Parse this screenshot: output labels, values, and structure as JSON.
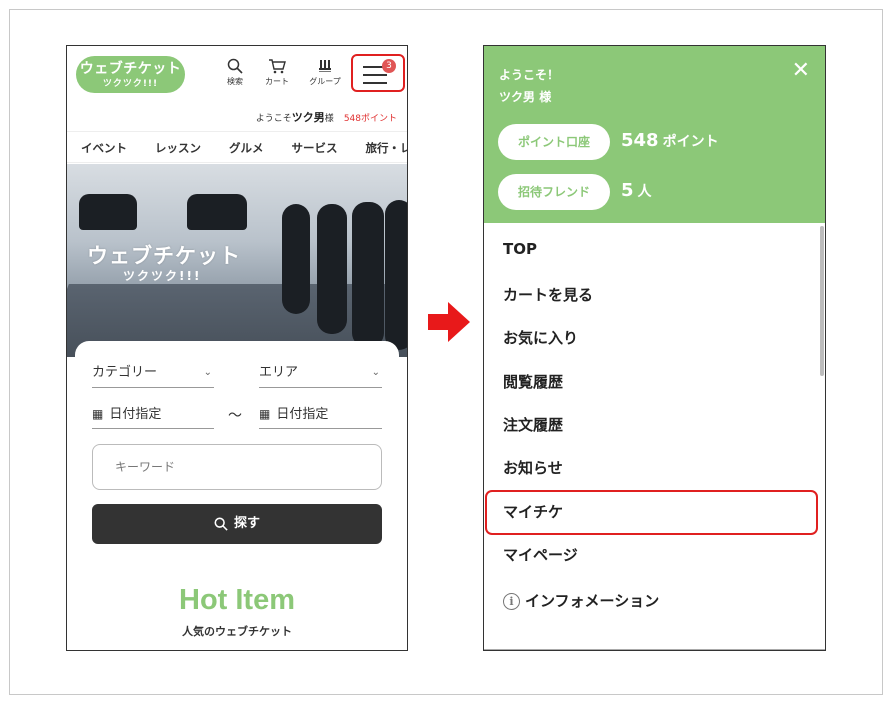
{
  "left": {
    "logo": {
      "line1": "ウェブチケット",
      "line2": "ツクツク!!!"
    },
    "header_icons": [
      {
        "name": "search-icon",
        "label": "検索"
      },
      {
        "name": "cart-icon",
        "label": "カート"
      },
      {
        "name": "group-icon",
        "label": "グループ"
      }
    ],
    "menu_badge": "3",
    "welcome": {
      "prefix": "ようこそ",
      "user": "ツク男",
      "suffix": "様",
      "points": "548ポイント"
    },
    "categories": [
      "イベント",
      "レッスン",
      "グルメ",
      "サービス",
      "旅行・レジ"
    ],
    "hero": {
      "title": "ウェブチケット",
      "subtitle": "ツクツク!!!"
    },
    "search": {
      "category": "カテゴリー",
      "area": "エリア",
      "date_from": "日付指定",
      "date_tilde": "〜",
      "date_to": "日付指定",
      "keyword_placeholder": "キーワード",
      "button": "探す"
    },
    "hot": {
      "title": "Hot Item",
      "subtitle": "人気のウェブチケット"
    }
  },
  "right": {
    "greeting": "ようこそ！",
    "user": "ツク男",
    "user_suffix": "様",
    "close": "✕",
    "points_label": "ポイント口座",
    "points_value": "548",
    "points_unit": "ポイント",
    "invite_label": "招待フレンド",
    "invite_value": "5",
    "invite_unit": "人",
    "menu": [
      "TOP",
      "カートを見る",
      "お気に入り",
      "閲覧履歴",
      "注文履歴",
      "お知らせ",
      "マイチケ",
      "マイページ",
      "インフォメーション"
    ]
  },
  "colors": {
    "brand_green": "#8cc878",
    "highlight_red": "#e02020",
    "badge_red": "#e05555"
  }
}
